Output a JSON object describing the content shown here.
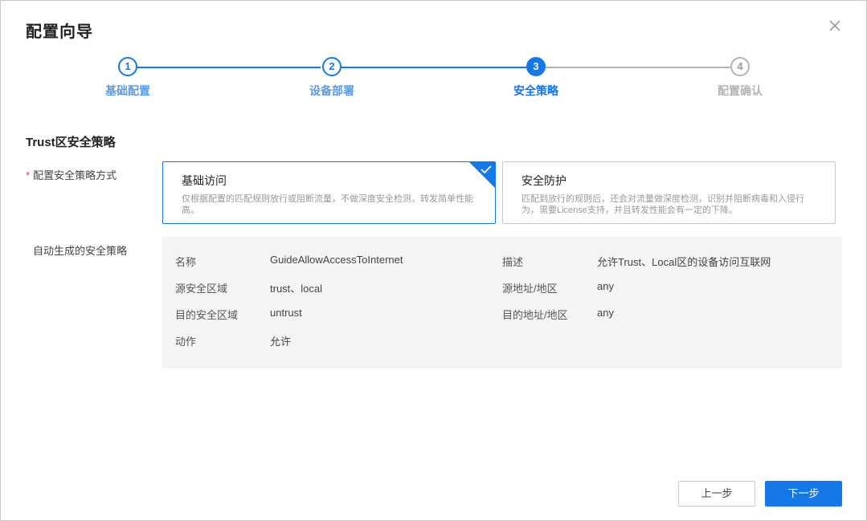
{
  "dialog": {
    "title": "配置向导"
  },
  "stepper": {
    "steps": [
      {
        "num": "1",
        "label": "基础配置",
        "state": "done"
      },
      {
        "num": "2",
        "label": "设备部署",
        "state": "done"
      },
      {
        "num": "3",
        "label": "安全策略",
        "state": "active"
      },
      {
        "num": "4",
        "label": "配置确认",
        "state": "todo"
      }
    ]
  },
  "section": {
    "title": "Trust区安全策略",
    "mode_label_required": "*",
    "mode_label": "配置安全策略方式",
    "auto_label": "自动生成的安全策略"
  },
  "options": [
    {
      "title": "基础访问",
      "desc": "仅根据配置的匹配规则放行或阻断流量，不做深度安全检测，转发简单性能高。",
      "selected": true
    },
    {
      "title": "安全防护",
      "desc": "匹配到放行的规则后，还会对流量做深度检测，识别并阻断病毒和入侵行为，需要License支持，并且转发性能会有一定的下降。",
      "selected": false
    }
  ],
  "policy": {
    "name_key": "名称",
    "name_val": "GuideAllowAccessToInternet",
    "desc_key": "描述",
    "desc_val": "允许Trust、Local区的设备访问互联网",
    "src_zone_key": "源安全区域",
    "src_zone_val": "trust、local",
    "src_addr_key": "源地址/地区",
    "src_addr_val": "any",
    "dst_zone_key": "目的安全区域",
    "dst_zone_val": "untrust",
    "dst_addr_key": "目的地址/地区",
    "dst_addr_val": "any",
    "action_key": "动作",
    "action_val": "允许"
  },
  "footer": {
    "prev_label": "上一步",
    "next_label": "下一步"
  },
  "colors": {
    "primary": "#1677e6",
    "pending": "#b4b4b4",
    "required": "#e0413a"
  },
  "icons": {
    "close": "close-icon",
    "selected_check": "check-icon"
  }
}
